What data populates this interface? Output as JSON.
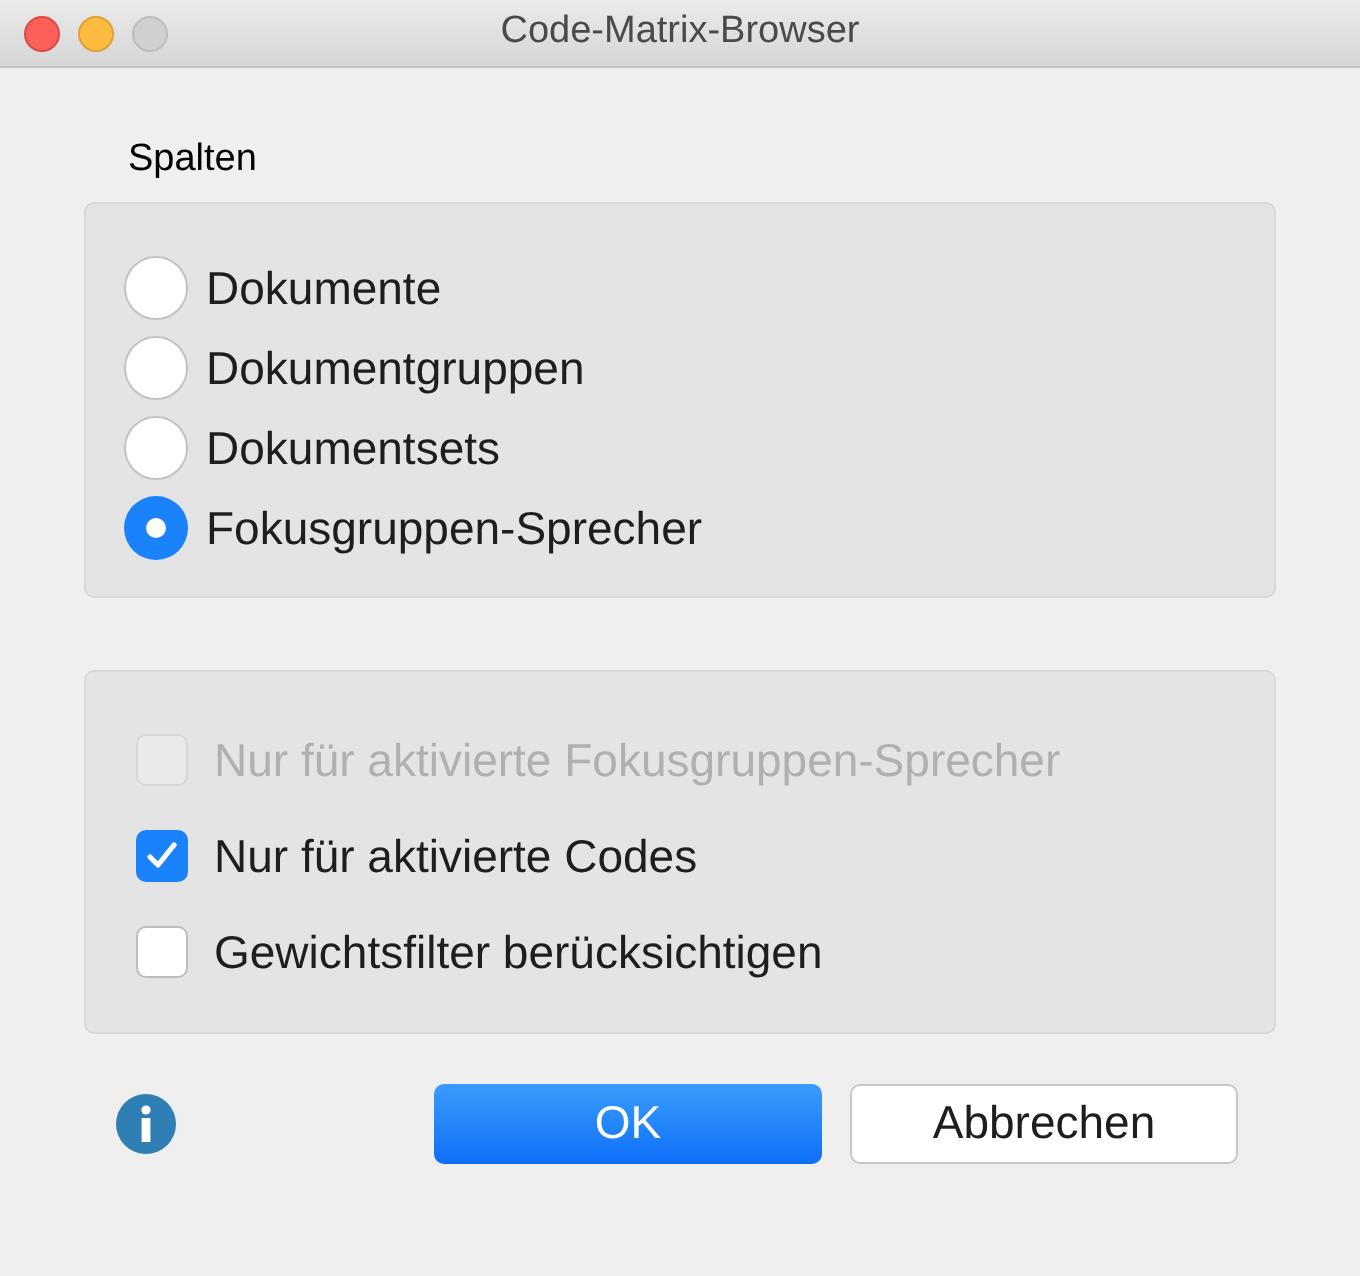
{
  "window": {
    "title": "Code-Matrix-Browser"
  },
  "columns_group": {
    "label": "Spalten",
    "options": [
      {
        "label": "Dokumente",
        "selected": false
      },
      {
        "label": "Dokumentgruppen",
        "selected": false
      },
      {
        "label": "Dokumentsets",
        "selected": false
      },
      {
        "label": "Fokusgruppen-Sprecher",
        "selected": true
      }
    ]
  },
  "filters": [
    {
      "label": "Nur für aktivierte Fokusgruppen-Sprecher",
      "checked": false,
      "disabled": true
    },
    {
      "label": "Nur für aktivierte Codes",
      "checked": true,
      "disabled": false
    },
    {
      "label": "Gewichtsfilter berücksichtigen",
      "checked": false,
      "disabled": false
    }
  ],
  "buttons": [
    {
      "label": "OK",
      "kind": "primary"
    },
    {
      "label": "Abbrechen",
      "kind": "secondary"
    }
  ]
}
